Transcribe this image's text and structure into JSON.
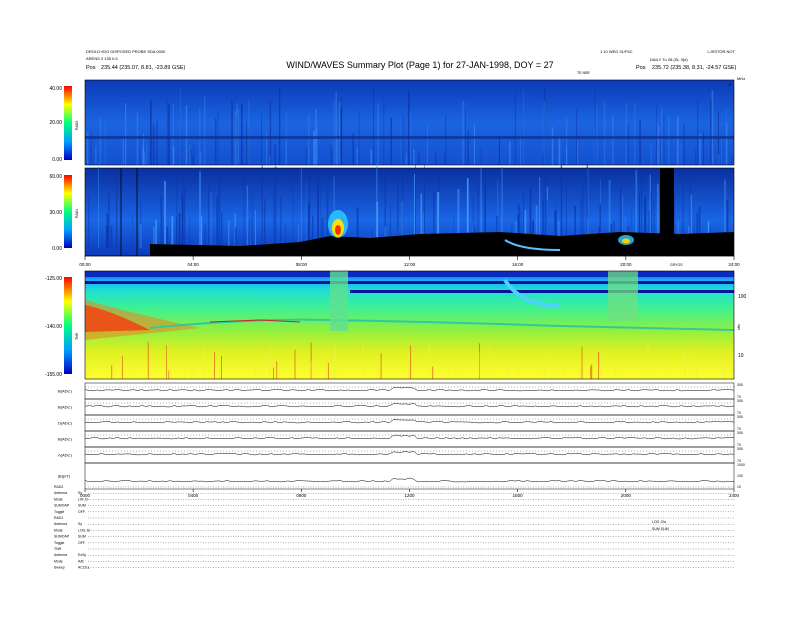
{
  "header": {
    "left_line1": "DROLD+EIG DISPOSED PROBE SDA 0000",
    "left_line2": "ARENS  2 135 0.5",
    "left_pos_label": "Pos",
    "left_pos_value": "235.44 (235.07, 8.81, -23.89 GSE)",
    "right_line1": "1.10 WED 31/F5C",
    "right_line1b": "LJSSTOR.NOT",
    "right_line2": "DAILY  Tu 28 (SL 3)d)",
    "right_pos_label": "Pos",
    "right_pos_value": "235.72 (235.38, 8.31, -24.57 GSE)",
    "right_small": "TE.NRE"
  },
  "title": "WIND/WAVES Summary Plot (Page 1) for 27-JAN-1998, DOY = 27",
  "panels": {
    "rad2": {
      "label": "RAD2",
      "ticks": [
        "40.00",
        "20.00",
        "0.00"
      ],
      "right_top": "MHz",
      "right_bot": "0"
    },
    "rad1": {
      "label": "RAD1",
      "ticks": [
        "60.00",
        "30.00",
        "0.00"
      ]
    },
    "tnr": {
      "label": "TNR",
      "ticks": [
        "-125.00",
        "-140.00",
        "-155.00"
      ],
      "right_ticks": [
        "100",
        "10"
      ],
      "right_unit": "kHz"
    },
    "time_axis_1": [
      "00:00",
      "04:00",
      "08:00",
      "12:00",
      "16:00",
      "20:00",
      "24:00"
    ],
    "time_axis_1_label": "GRYOS",
    "time_axis_2": [
      "0000",
      "0400",
      "0800",
      "1200",
      "1600",
      "2000",
      "2400"
    ]
  },
  "line_panels": [
    {
      "label": "B(ADC)",
      "right": [
        "300",
        "70"
      ]
    },
    {
      "label": "B(ADC)",
      "right": [
        "300",
        "70"
      ]
    },
    {
      "label": "D(ADC)",
      "right": [
        "300",
        "70"
      ]
    },
    {
      "label": "B(ADC)",
      "right": [
        "300",
        "70"
      ]
    },
    {
      "label": "Λ(ADC)",
      "right": [
        "300",
        "70"
      ]
    },
    {
      "label": "|B|(nT)",
      "right": [
        "1000",
        "100",
        "10"
      ]
    }
  ],
  "params": [
    {
      "k": "RAD2",
      "v": ""
    },
    {
      "k": "Antenna",
      "v": "Sy"
    },
    {
      "k": "Mode",
      "v": "LIN J2"
    },
    {
      "k": "SUMOAP",
      "v": "SUM"
    },
    {
      "k": "Toggle",
      "v": "OFF"
    },
    {
      "k": "RAD1",
      "v": ""
    },
    {
      "k": "Antenna",
      "v": "Sy"
    },
    {
      "k": "Mode",
      "v": "LOG J2"
    },
    {
      "k": "SUMOAP",
      "v": "SUM"
    },
    {
      "k": "Toggle",
      "v": "OFF"
    },
    {
      "k": "TNR",
      "v": ""
    },
    {
      "k": "Antenna",
      "v": "ExSy"
    },
    {
      "k": "Mode",
      "v": "A/B"
    },
    {
      "k": "Sweep",
      "v": "ACCEL"
    }
  ],
  "param_notes": [
    "LOG J2a",
    "SUM     SUM"
  ],
  "colors": {
    "bg_blue": "#1e5fd8",
    "deep_blue": "#0a2fa8",
    "black": "#000000"
  }
}
